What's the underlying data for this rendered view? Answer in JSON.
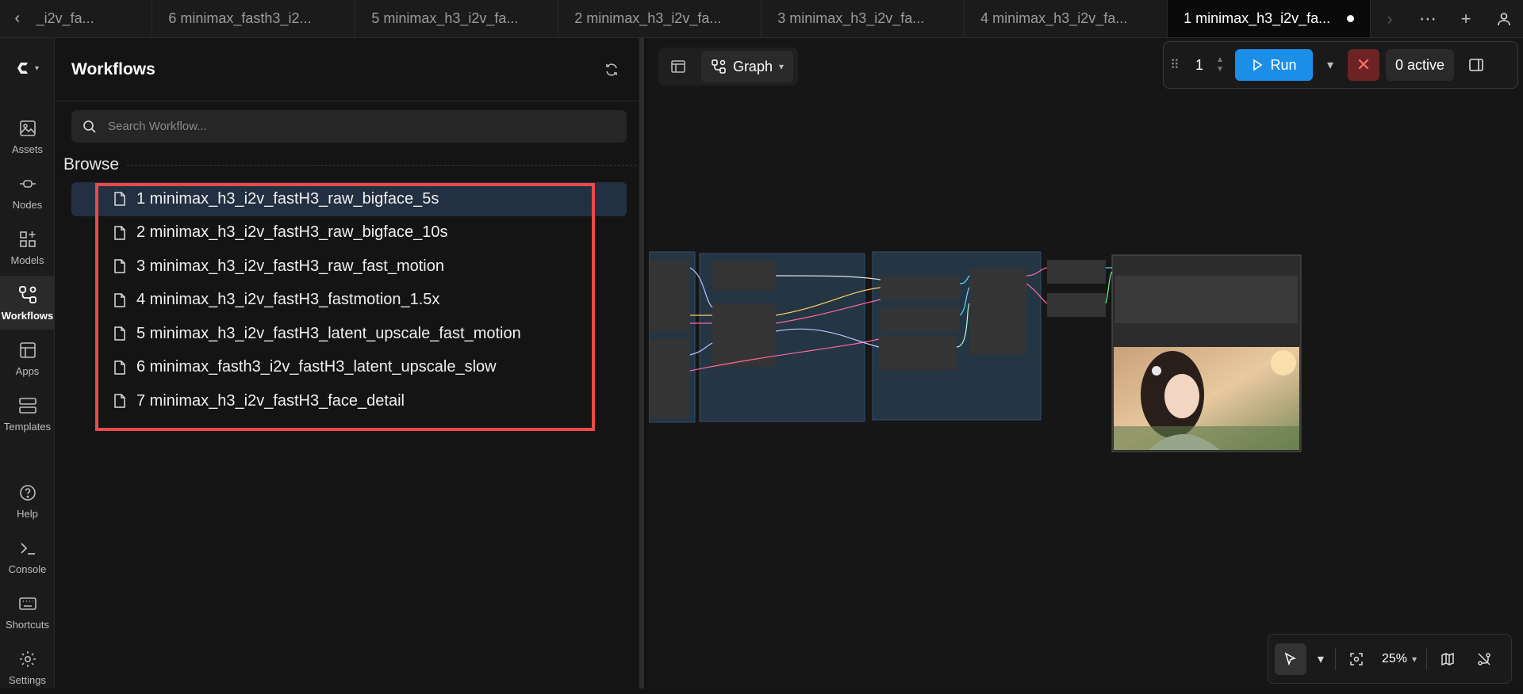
{
  "tabs": [
    {
      "label": "_i2v_fa..."
    },
    {
      "label": "6 minimax_fasth3_i2..."
    },
    {
      "label": "5 minimax_h3_i2v_fa..."
    },
    {
      "label": "2 minimax_h3_i2v_fa..."
    },
    {
      "label": "3 minimax_h3_i2v_fa..."
    },
    {
      "label": "4 minimax_h3_i2v_fa..."
    },
    {
      "label": "1 minimax_h3_i2v_fa...",
      "active": true,
      "unsaved": true
    }
  ],
  "rail": {
    "items": [
      {
        "label": "Assets",
        "icon": "image-icon"
      },
      {
        "label": "Nodes",
        "icon": "node-icon"
      },
      {
        "label": "Models",
        "icon": "models-icon"
      },
      {
        "label": "Workflows",
        "icon": "workflows-icon",
        "active": true
      },
      {
        "label": "Apps",
        "icon": "apps-icon"
      },
      {
        "label": "Templates",
        "icon": "templates-icon"
      },
      {
        "label": "Help",
        "icon": "help-icon"
      },
      {
        "label": "Console",
        "icon": "console-icon"
      },
      {
        "label": "Shortcuts",
        "icon": "keyboard-icon"
      },
      {
        "label": "Settings",
        "icon": "gear-icon"
      }
    ]
  },
  "panel": {
    "title": "Workflows",
    "search_placeholder": "Search Workflow...",
    "browse_label": "Browse",
    "workflows": [
      {
        "label": "1 minimax_h3_i2v_fastH3_raw_bigface_5s",
        "selected": true
      },
      {
        "label": "2 minimax_h3_i2v_fastH3_raw_bigface_10s"
      },
      {
        "label": "3 minimax_h3_i2v_fastH3_raw_fast_motion"
      },
      {
        "label": "4 minimax_h3_i2v_fastH3_fastmotion_1.5x"
      },
      {
        "label": "5 minimax_h3_i2v_fastH3_latent_upscale_fast_motion"
      },
      {
        "label": "6 minimax_fasth3_i2v_fastH3_latent_upscale_slow"
      },
      {
        "label": "7 minimax_h3_i2v_fastH3_face_detail"
      }
    ]
  },
  "canvas": {
    "view_mode": "Graph",
    "batch_count": "1",
    "run_label": "Run",
    "active_label": "0 active",
    "zoom_label": "25%",
    "colors": {
      "run": "#1b8ee8",
      "stop": "#6b2323",
      "highlight": "#e94a4a",
      "selected_row": "#233042"
    }
  }
}
